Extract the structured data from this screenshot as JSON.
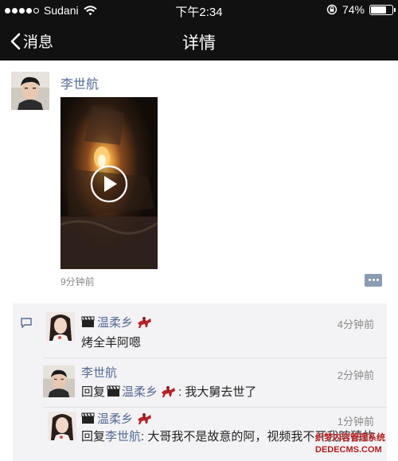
{
  "status_bar": {
    "carrier": "Sudani",
    "time": "下午2:34",
    "battery": "74%",
    "battery_level": 0.74,
    "signal_bars": 4
  },
  "nav": {
    "back_label": "消息",
    "title": "详情"
  },
  "post": {
    "author": "李世航",
    "time": "9分钟前"
  },
  "comments": [
    {
      "author": "温柔乡",
      "time": "4分钟前",
      "text": "烤全羊阿嗯"
    },
    {
      "author": "李世航",
      "time": "2分钟前",
      "reply_prefix": "回复",
      "reply_to": "温柔乡",
      "text": ": 我大舅去世了"
    },
    {
      "author": "温柔乡",
      "time": "1分钟前",
      "reply_prefix": "回复",
      "reply_to": "李世航",
      "text": ": 大哥我不是故意的阿，视频我不开我瞎猜的"
    }
  ],
  "watermark": {
    "line1": "织梦内容管理系统",
    "line2": "DEDECMS.COM"
  }
}
